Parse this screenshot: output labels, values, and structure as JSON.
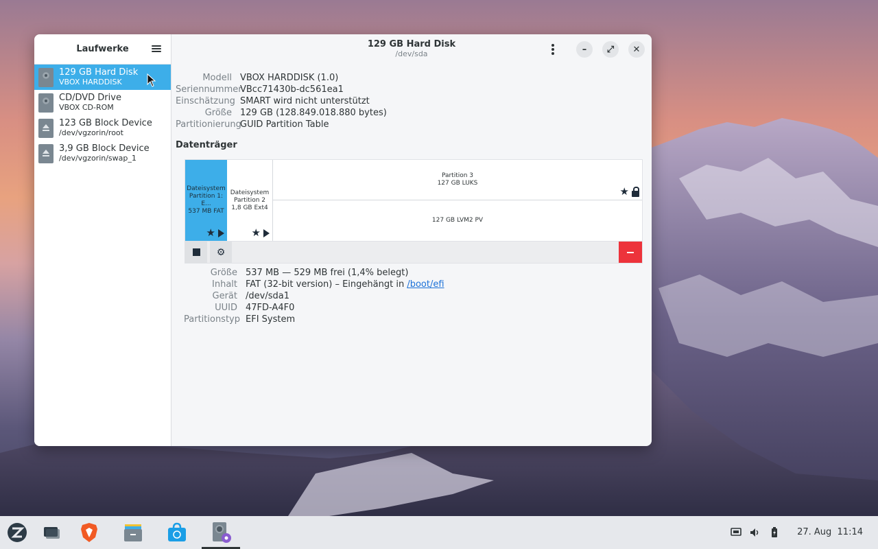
{
  "sidebar": {
    "title": "Laufwerke",
    "menu_icon": "hamburger-icon",
    "drives": [
      {
        "name": "129 GB Hard Disk",
        "sub": "VBOX HARDDISK",
        "icon": "harddisk-icon"
      },
      {
        "name": "CD/DVD Drive",
        "sub": "VBOX CD-ROM",
        "icon": "optical-drive-icon"
      },
      {
        "name": "123 GB Block Device",
        "sub": "/dev/vgzorin/root",
        "icon": "block-device-icon"
      },
      {
        "name": "3,9 GB Block Device",
        "sub": "/dev/vgzorin/swap_1",
        "icon": "block-device-icon"
      }
    ]
  },
  "header": {
    "title": "129 GB Hard Disk",
    "subtitle": "/dev/sda",
    "minimize": "–",
    "maximize": "⤢",
    "close": "✕"
  },
  "disk_props": [
    {
      "label": "Modell",
      "value": "VBOX HARDDISK (1.0)"
    },
    {
      "label": "Seriennummer",
      "value": "VBcc71430b-dc561ea1"
    },
    {
      "label": "Einschätzung",
      "value": "SMART wird nicht unterstützt"
    },
    {
      "label": "Größe",
      "value": "129 GB (128.849.018.880 bytes)"
    },
    {
      "label": "Partitionierung",
      "value": "GUID Partition Table"
    }
  ],
  "volumes_title": "Datenträger",
  "partitions": {
    "p1": {
      "line1": "Dateisystem",
      "line2": "Partition 1: E...",
      "line3": "537 MB FAT"
    },
    "p2": {
      "line1": "Dateisystem",
      "line2": "Partition 2",
      "line3": "1,8 GB Ext4"
    },
    "p3": {
      "line1": "Partition 3",
      "line2": "127 GB LUKS"
    },
    "p4": {
      "line1": "127 GB LVM2 PV"
    }
  },
  "partition_props": {
    "size": {
      "label": "Größe",
      "value": "537 MB — 529 MB frei (1,4% belegt)"
    },
    "contents": {
      "label": "Inhalt",
      "value": "FAT (32-bit version) – Eingehängt in ",
      "link": "/boot/efi"
    },
    "device": {
      "label": "Gerät",
      "value": "/dev/sda1"
    },
    "uuid": {
      "label": "UUID",
      "value": "47FD-A4F0"
    },
    "type": {
      "label": "Partitionstyp",
      "value": "EFI System"
    }
  },
  "taskbar": {
    "apps": [
      "zorin-menu-icon",
      "workspaces-icon",
      "brave-browser-icon",
      "files-icon",
      "software-store-icon",
      "disks-icon"
    ],
    "tray": [
      "network-icon",
      "volume-icon",
      "battery-icon"
    ],
    "clock": "27. Aug  11:14"
  },
  "colors": {
    "accent": "#3daee9",
    "danger": "#ed333b",
    "link": "#1c71d8"
  }
}
